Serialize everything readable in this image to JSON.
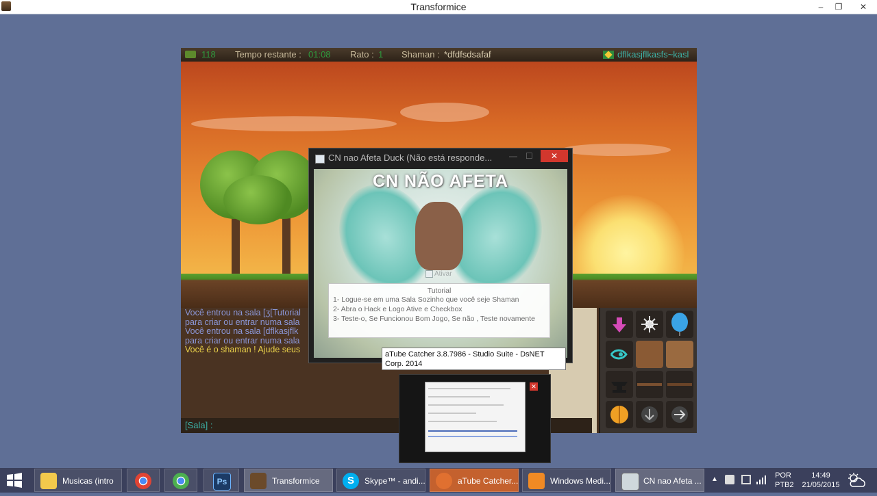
{
  "window": {
    "title": "Transformice",
    "minimize": "–",
    "restore": "❐",
    "close": "✕"
  },
  "hud": {
    "cheese_count": "118",
    "time_label": "Tempo restante :",
    "time_value": "01:08",
    "rato_label": "Rato :",
    "rato_value": "1",
    "shaman_label": "Shaman :",
    "shaman_value": "*dfdfsdsafaf",
    "player_name": "dflkasjflkasfs~kasl"
  },
  "chat": {
    "lines": [
      "Você entrou na sala [ʒ[Tutorial",
      "para criar ou entrar numa sala",
      "Você entrou na sala [dflkasjflk",
      "para criar ou entrar numa sala"
    ],
    "shaman_line": "Você é o shaman ! Ajude seus",
    "input_label": "[Sala] :"
  },
  "popup": {
    "title": "CN nao Afeta Duck (Não está responde...",
    "close": "✕",
    "minimize": "—",
    "maximize": "☐",
    "banner": "CN NÃO AFETA",
    "checkbox_label": "Ativar",
    "tutorial_heading": "Tutorial",
    "tutorial_lines": [
      "1- Logue-se em uma Sala Sozinho que você seje Shaman",
      "2- Abra o Hack e Logo Ative e Checkbox",
      "3- Teste-o, Se Funcionou Bom Jogo, Se não , Teste novamente"
    ]
  },
  "tooltip": {
    "text": "aTube Catcher 3.8.7986 - Studio Suite - DsNET Corp. 2014"
  },
  "thumbnail": {
    "close": "✕"
  },
  "taskbar": {
    "items": [
      {
        "label": "Musicas (intro",
        "icon": "folder-icon",
        "color": "#f2c94c"
      },
      {
        "label": "",
        "icon": "chrome-icon",
        "color": "#e04434"
      },
      {
        "label": "",
        "icon": "chrome-canary-icon",
        "color": "#4caf50"
      },
      {
        "label": "Ps",
        "icon": "photoshop-icon",
        "color": "#1c3b66"
      },
      {
        "label": "Transformice",
        "icon": "transformice-icon",
        "color": "#6b4a2a"
      },
      {
        "label": "Skype™ - andi...",
        "icon": "skype-icon",
        "color": "#00aff0"
      },
      {
        "label": "aTube Catcher...",
        "icon": "atube-icon",
        "color": "#e07030"
      },
      {
        "label": "Windows Medi...",
        "icon": "media-player-icon",
        "color": "#f08a24"
      },
      {
        "label": "CN nao Afeta ...",
        "icon": "app-window-icon",
        "color": "#cfd8dc"
      }
    ],
    "tray": {
      "lang_top": "POR",
      "lang_bottom": "PTB2",
      "time": "14:49",
      "date": "21/05/2015"
    }
  }
}
